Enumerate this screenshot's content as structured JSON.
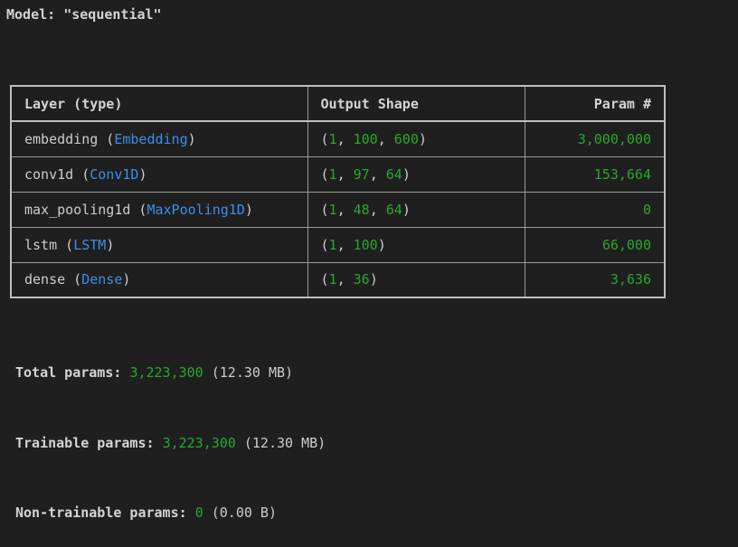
{
  "model_title": "Model: \"sequential\"",
  "table": {
    "headers": {
      "layer": "Layer (type)",
      "shape": "Output Shape",
      "param": "Param #"
    },
    "rows": [
      {
        "name": "embedding",
        "type": "Embedding",
        "shape": [
          "1",
          "100",
          "600"
        ],
        "params": "3,000,000"
      },
      {
        "name": "conv1d",
        "type": "Conv1D",
        "shape": [
          "1",
          "97",
          "64"
        ],
        "params": "153,664"
      },
      {
        "name": "max_pooling1d",
        "type": "MaxPooling1D",
        "shape": [
          "1",
          "48",
          "64"
        ],
        "params": "0"
      },
      {
        "name": "lstm",
        "type": "LSTM",
        "shape": [
          "1",
          "100"
        ],
        "params": "66,000"
      },
      {
        "name": "dense",
        "type": "Dense",
        "shape": [
          "1",
          "36"
        ],
        "params": "3,636"
      }
    ]
  },
  "totals": {
    "total": {
      "label": "Total params:",
      "value": "3,223,300",
      "size": "(12.30 MB)"
    },
    "trainable": {
      "label": "Trainable params:",
      "value": "3,223,300",
      "size": "(12.30 MB)"
    },
    "non_trainable": {
      "label": "Non-trainable params:",
      "value": "0",
      "size": "(0.00 B)"
    }
  },
  "colors": {
    "background": "#1f1f1f",
    "number": "#26a82c",
    "class_name": "#3b8eea",
    "text": "#cccccc"
  }
}
